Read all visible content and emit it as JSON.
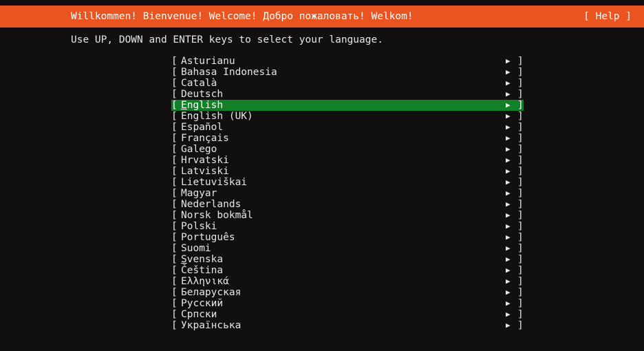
{
  "header": {
    "title": "Willkommen! Bienvenue! Welcome! Добро пожаловать! Welkom!",
    "help_label": "[ Help ]",
    "background_color": "#e95420",
    "text_color": "#ffffff"
  },
  "instruction": {
    "text": "Use UP, DOWN and ENTER keys to select your language."
  },
  "list": {
    "bracket_open": "[",
    "bracket_close": "]",
    "arrow_icon": "▶",
    "selected_index": 4,
    "highlight_color": "#118026",
    "text_color": "#e8e6e3",
    "items": [
      {
        "label": "Asturianu",
        "accel": "",
        "rest": "Asturianu"
      },
      {
        "label": "Bahasa Indonesia",
        "accel": "",
        "rest": "Bahasa Indonesia"
      },
      {
        "label": "Català",
        "accel": "",
        "rest": "Català"
      },
      {
        "label": "Deutsch",
        "accel": "",
        "rest": "Deutsch"
      },
      {
        "label": "English",
        "accel": "E",
        "rest": "nglish"
      },
      {
        "label": "English (UK)",
        "accel": "",
        "rest": "English (UK)"
      },
      {
        "label": "Español",
        "accel": "",
        "rest": "Español"
      },
      {
        "label": "Français",
        "accel": "",
        "rest": "Français"
      },
      {
        "label": "Galego",
        "accel": "",
        "rest": "Galego"
      },
      {
        "label": "Hrvatski",
        "accel": "",
        "rest": "Hrvatski"
      },
      {
        "label": "Latviski",
        "accel": "",
        "rest": "Latviski"
      },
      {
        "label": "Lietuviškai",
        "accel": "",
        "rest": "Lietuviškai"
      },
      {
        "label": "Magyar",
        "accel": "",
        "rest": "Magyar"
      },
      {
        "label": "Nederlands",
        "accel": "",
        "rest": "Nederlands"
      },
      {
        "label": "Norsk bokmål",
        "accel": "",
        "rest": "Norsk bokmål"
      },
      {
        "label": "Polski",
        "accel": "",
        "rest": "Polski"
      },
      {
        "label": "Português",
        "accel": "",
        "rest": "Português"
      },
      {
        "label": "Suomi",
        "accel": "",
        "rest": "Suomi"
      },
      {
        "label": "Svenska",
        "accel": "S",
        "rest": "venska"
      },
      {
        "label": "Čeština",
        "accel": "",
        "rest": "Čeština"
      },
      {
        "label": "Ελληνικά",
        "accel": "",
        "rest": "Ελληνικά"
      },
      {
        "label": "Беларуская",
        "accel": "",
        "rest": "Беларуская"
      },
      {
        "label": "Русский",
        "accel": "",
        "rest": "Русский"
      },
      {
        "label": "Српски",
        "accel": "",
        "rest": "Српски"
      },
      {
        "label": "Українська",
        "accel": "",
        "rest": "Українська"
      }
    ]
  }
}
